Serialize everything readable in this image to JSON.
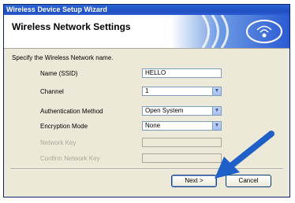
{
  "window": {
    "title": "Wireless Device Setup Wizard"
  },
  "banner": {
    "title": "Wireless Network Settings"
  },
  "instruction": "Specify the Wireless Network name.",
  "fields": [
    {
      "label": "Name (SSID)",
      "value": "HELLO",
      "type": "text",
      "enabled": true
    },
    {
      "label": "Channel",
      "value": "1",
      "type": "select",
      "enabled": true
    },
    {
      "label": "Authentication Method",
      "value": "Open System",
      "type": "select",
      "enabled": true
    },
    {
      "label": "Encryption Mode",
      "value": "None",
      "type": "select",
      "enabled": true
    },
    {
      "label": "Network Key",
      "value": "",
      "type": "text",
      "enabled": false
    },
    {
      "label": "Confirm Network Key",
      "value": "",
      "type": "text",
      "enabled": false
    }
  ],
  "buttons": {
    "next": "Next >",
    "cancel": "Cancel"
  },
  "colors": {
    "titlebar": "#1f4fbf",
    "arrow": "#1f5fc8",
    "panel": "#ece9d8"
  },
  "icons": {
    "banner": "wireless-signal-icon",
    "pointer": "pointer-arrow-icon"
  }
}
